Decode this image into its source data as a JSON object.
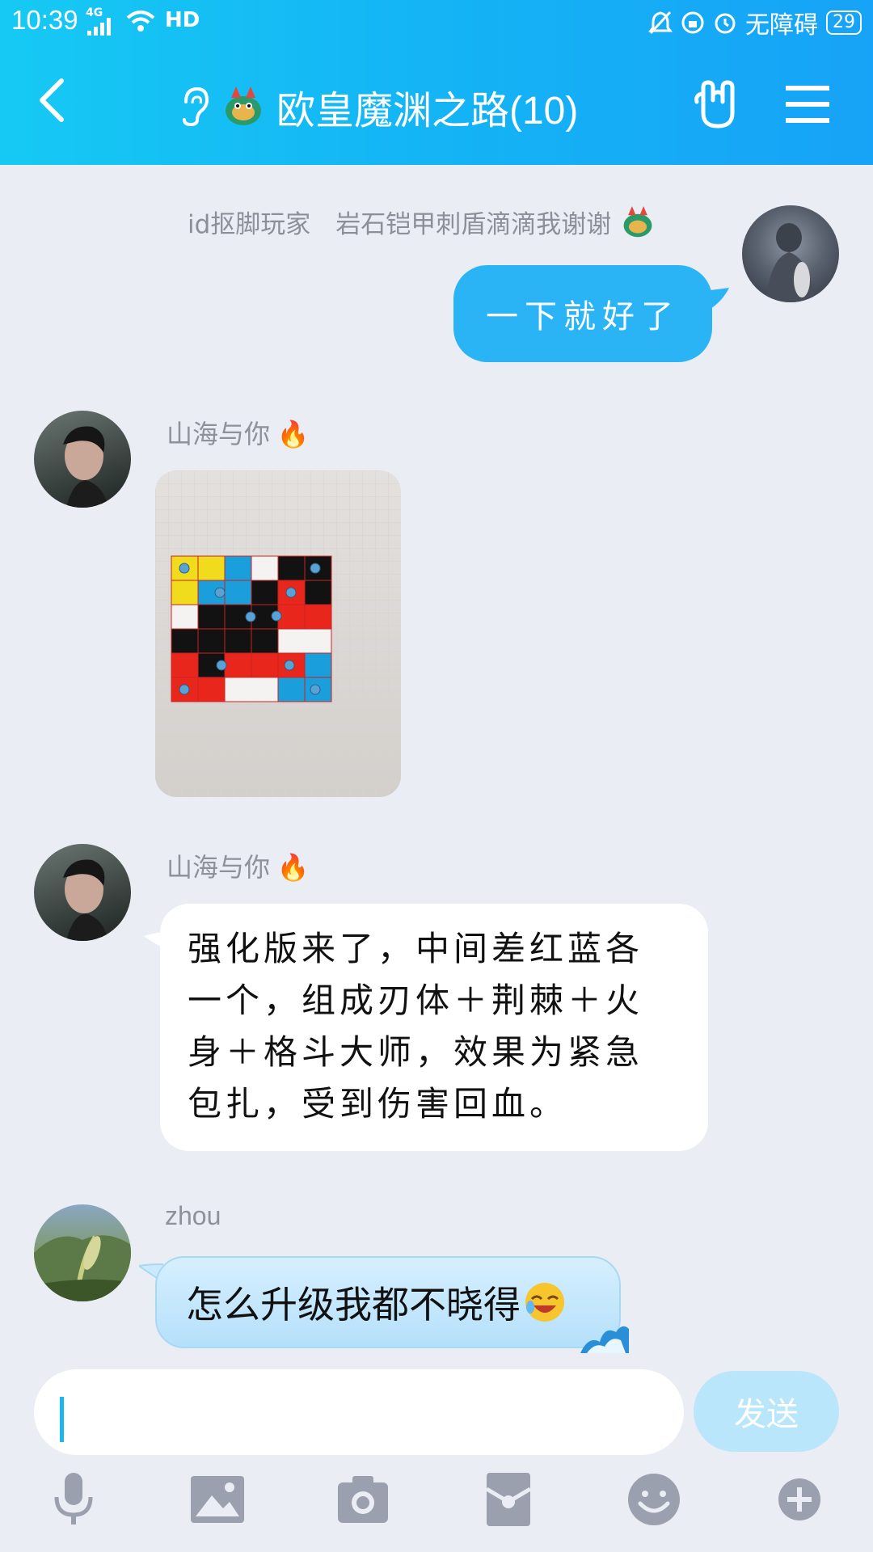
{
  "status_bar": {
    "time": "10:39",
    "network": "4G",
    "hd": "HD",
    "accessibility": "无障碍",
    "battery": "29"
  },
  "header": {
    "title": "欧皇魔渊之路(10)"
  },
  "messages": [
    {
      "type": "system",
      "text": "id抠脚玩家　岩石铠甲刺盾滴滴我谢谢"
    },
    {
      "type": "outgoing",
      "text": "一下就好了"
    },
    {
      "type": "incoming-image",
      "sender": "山海与你"
    },
    {
      "type": "incoming",
      "sender": "山海与你",
      "lines": [
        "强化版来了，中间差红蓝各",
        "一个，组成刃体＋荆棘＋火",
        "身＋格斗大师，效果为紧急",
        "包扎，受到伤害回血。"
      ]
    },
    {
      "type": "incoming-blue",
      "sender": "zhou",
      "text": "怎么升级我都不晓得"
    }
  ],
  "input": {
    "value": "",
    "send_label": "发送"
  },
  "toolbar": [
    "microphone-icon",
    "image-icon",
    "camera-icon",
    "red-packet-icon",
    "emoji-icon",
    "plus-icon"
  ],
  "colors": {
    "header": "#16b6f5",
    "outgoing_bubble": "#2ab4f6",
    "send_button": "#b9e6fa",
    "background": "#eaedf4"
  }
}
